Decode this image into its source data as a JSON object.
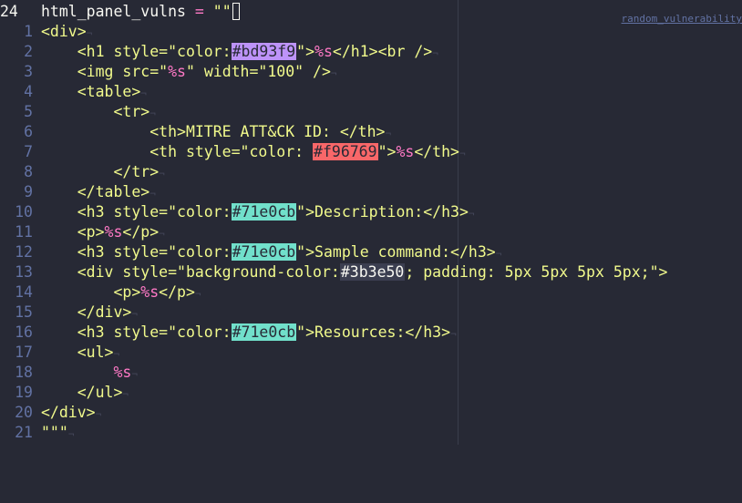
{
  "editor": {
    "current_line_number": "24",
    "first_line_tokens": {
      "var": "html_panel_vulns",
      "op": " = ",
      "str": "\"\""
    },
    "topright_text": "random_vulnerability",
    "line_numbers": [
      "1",
      "2",
      "3",
      "4",
      "5",
      "6",
      "7",
      "8",
      "9",
      "10",
      "11",
      "12",
      "13",
      "14",
      "15",
      "16",
      "17",
      "18",
      "19",
      "20",
      "21"
    ],
    "lines": {
      "l1": "<div>",
      "l2a": "    <h1 style=\"color:",
      "l2_color": "#bd93f9",
      "l2b": "\">",
      "l2_ph": "%s",
      "l2c": "</h1><br />",
      "l3a": "    <img src=\"",
      "l3_ph": "%s",
      "l3b": "\" width=\"100\" />",
      "l4": "    <table>",
      "l5": "        <tr>",
      "l6": "            <th>MITRE ATT&CK ID: </th>",
      "l7a": "            <th style=\"color: ",
      "l7_color": "#f96769",
      "l7b": "\">",
      "l7_ph": "%s",
      "l7c": "</th>",
      "l8": "        </tr>",
      "l9": "    </table>",
      "l10a": "    <h3 style=\"color:",
      "l10_color": "#71e0cb",
      "l10b": "\">Description:</h3>",
      "l11a": "    <p>",
      "l11_ph": "%s",
      "l11b": "</p>",
      "l12a": "    <h3 style=\"color:",
      "l12_color": "#71e0cb",
      "l12b": "\">Sample command:</h3>",
      "l13a": "    <div style=\"background-color:",
      "l13_color": "#3b3e50",
      "l13b": "; padding: 5px 5px 5px 5px;\">",
      "l14a": "        <p>",
      "l14_ph": "%s",
      "l14b": "</p>",
      "l15": "    </div>",
      "l16a": "    <h3 style=\"color:",
      "l16_color": "#71e0cb",
      "l16b": "\">Resources:</h3>",
      "l17": "    <ul>",
      "l18_ph": "        %s",
      "l19": "    </ul>",
      "l20": "</div>",
      "l21": "\"\"\""
    },
    "eol_marker": "¬"
  }
}
